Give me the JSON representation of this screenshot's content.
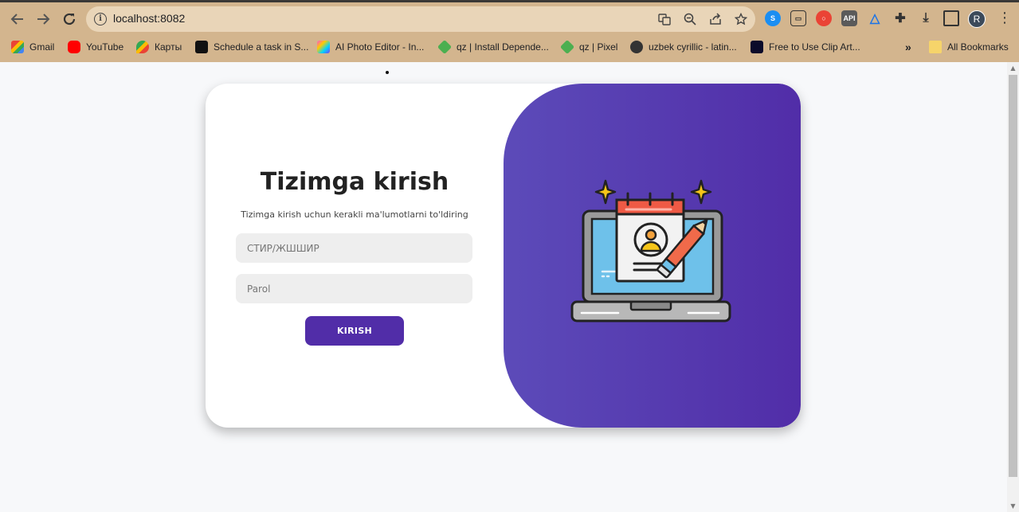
{
  "browser": {
    "url": "localhost:8082",
    "profile_initial": "R",
    "bookmarks": [
      {
        "label": "Gmail",
        "icon": "gmail-icon"
      },
      {
        "label": "YouTube",
        "icon": "youtube-icon"
      },
      {
        "label": "Карты",
        "icon": "maps-icon"
      },
      {
        "label": "Schedule a task in S...",
        "icon": "medium-icon"
      },
      {
        "label": "AI Photo Editor - In...",
        "icon": "photo-editor-icon"
      },
      {
        "label": "qz | Install Depende...",
        "icon": "qz-icon"
      },
      {
        "label": "qz | Pixel",
        "icon": "qz-icon"
      },
      {
        "label": "uzbek cyrillic - latin...",
        "icon": "globe-icon"
      },
      {
        "label": "Free to Use Clip Art...",
        "icon": "clipart-icon"
      }
    ],
    "all_bookmarks_label": "All Bookmarks",
    "more_bookmarks": "»",
    "extensions": [
      {
        "icon": "shazam-icon",
        "text": ""
      },
      {
        "icon": "reader-icon",
        "text": ""
      },
      {
        "icon": "record-icon",
        "text": ""
      },
      {
        "icon": "api-icon",
        "text": "API"
      },
      {
        "icon": "triangle-icon",
        "text": ""
      },
      {
        "icon": "puzzle-icon",
        "text": ""
      },
      {
        "icon": "download-icon",
        "text": ""
      },
      {
        "icon": "side-panel-icon",
        "text": ""
      }
    ]
  },
  "login": {
    "title": "Tizimga kirish",
    "subtitle": "Tizimga kirish uchun kerakli ma'lumotlarni to'ldiring",
    "tin_placeholder": "СТИР/ЖШШИР",
    "password_placeholder": "Parol",
    "submit_label": "KIRISH"
  },
  "colors": {
    "accent": "#512da8",
    "panel_gradient_start": "#5c4bb9",
    "panel_gradient_end": "#512da8"
  }
}
